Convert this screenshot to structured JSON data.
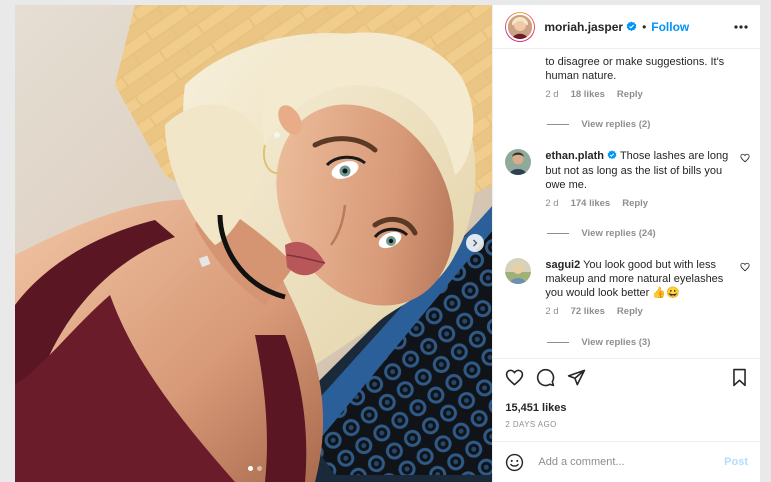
{
  "post": {
    "author": "moriah.jasper",
    "follow_label": "Follow",
    "separator": "•",
    "likes": "15,451 likes",
    "date": "2 DAYS AGO",
    "carousel_total": 2,
    "carousel_active": 1
  },
  "comments": {
    "partial_text": "to disagree or make suggestions. It's human nature.",
    "partial_time": "2 d",
    "partial_likes": "18 likes",
    "partial_reply": "Reply",
    "partial_view_replies": "View replies (2)",
    "items": [
      {
        "user": "ethan.plath",
        "verified": true,
        "text": "Those lashes are long but not as long as the list of bills you owe me.",
        "time": "2 d",
        "likes": "174 likes",
        "reply": "Reply",
        "view_replies": "View replies (24)"
      },
      {
        "user": "sagui2",
        "verified": false,
        "text": "You look good but with less makeup and more natural eyelashes you would look better 👍😀",
        "time": "2 d",
        "likes": "72 likes",
        "reply": "Reply",
        "view_replies": "View replies (3)"
      }
    ]
  },
  "composer": {
    "placeholder": "Add a comment...",
    "post_label": "Post"
  },
  "icons": {
    "verified": "verified-badge-icon",
    "more": "more-options-icon",
    "heart": "heart-icon",
    "comment": "comment-icon",
    "share": "share-icon",
    "save": "bookmark-icon",
    "emoji": "emoji-icon",
    "next": "chevron-right-icon"
  },
  "colors": {
    "accent": "#0095f6",
    "verified": "#0095f6",
    "post_disabled": "#b2dffc"
  }
}
